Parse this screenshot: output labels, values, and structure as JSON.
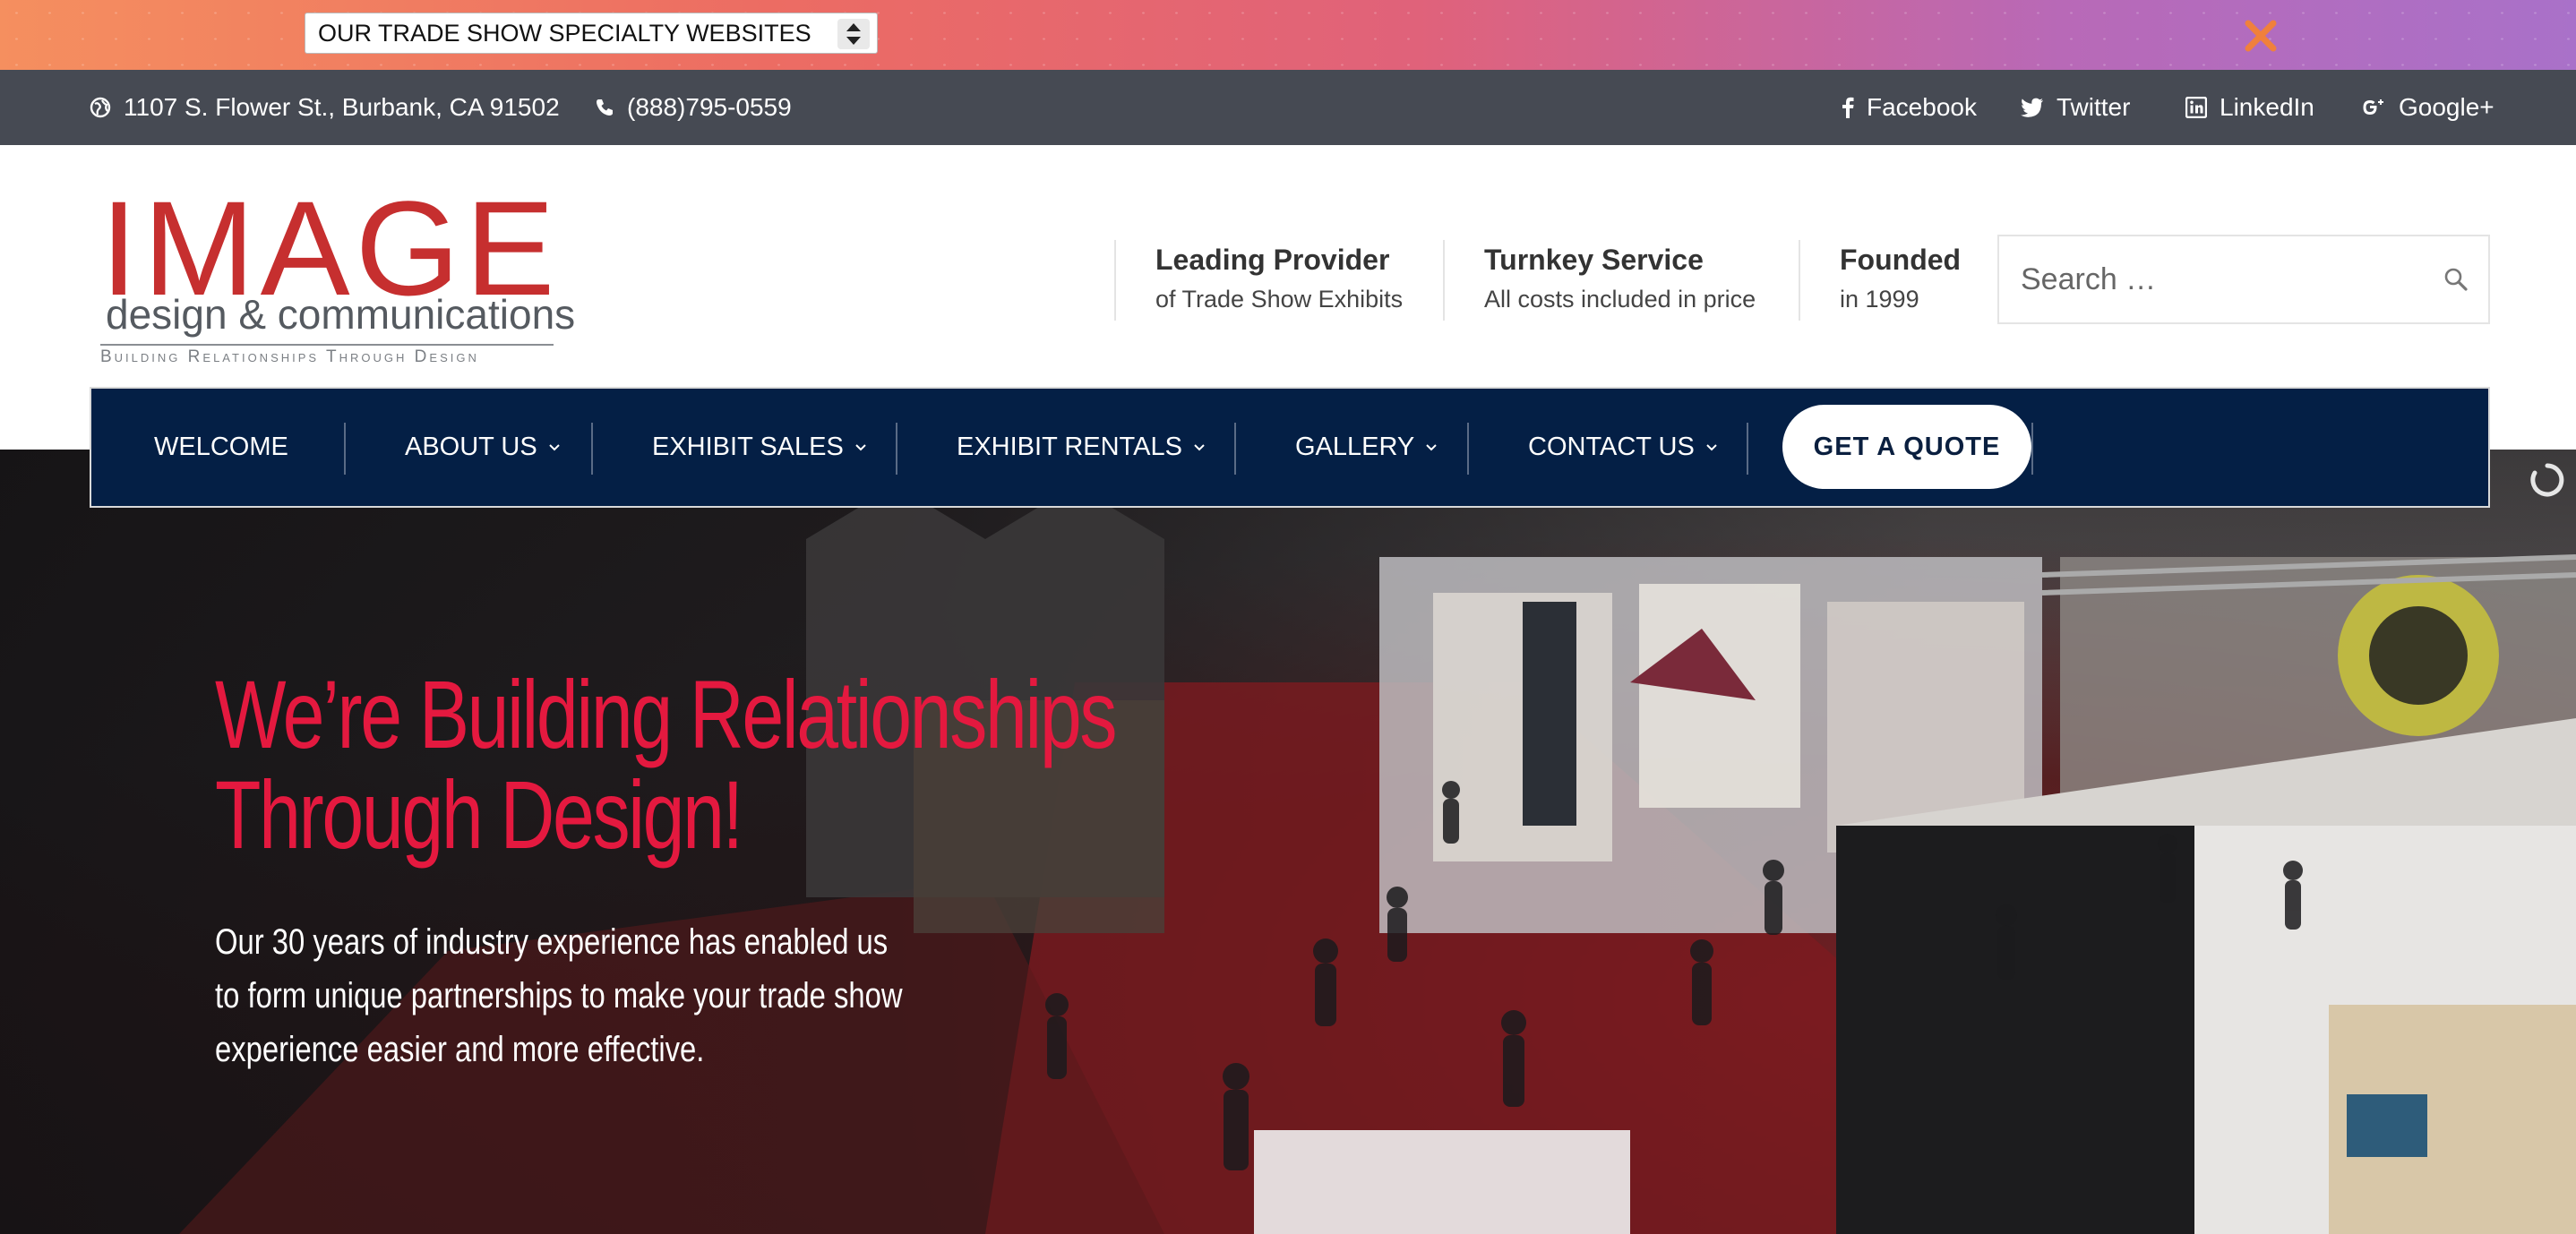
{
  "promo": {
    "select_value": "OUR TRADE SHOW SPECIALTY WEBSITES"
  },
  "contact": {
    "address": "1107 S. Flower St., Burbank, CA 91502",
    "phone": "(888)795-0559",
    "social": [
      {
        "label": "Facebook"
      },
      {
        "label": "Twitter"
      },
      {
        "label": "LinkedIn"
      },
      {
        "label": "Google+"
      }
    ]
  },
  "logo": {
    "main": "IMAGE",
    "sub": "design & communications",
    "tagline": "Building Relationships Through Design"
  },
  "features": [
    {
      "title": "Leading Provider",
      "subtitle": "of Trade Show Exhibits"
    },
    {
      "title": "Turnkey Service",
      "subtitle": "All costs included in price"
    },
    {
      "title": "Founded",
      "subtitle": "in 1999"
    }
  ],
  "search": {
    "placeholder": "Search …"
  },
  "nav": {
    "items": [
      {
        "label": "WELCOME"
      },
      {
        "label": "ABOUT US"
      },
      {
        "label": "EXHIBIT SALES"
      },
      {
        "label": "EXHIBIT RENTALS"
      },
      {
        "label": "GALLERY"
      },
      {
        "label": "CONTACT US"
      }
    ],
    "cta": "GET A QUOTE"
  },
  "hero": {
    "title_line1": "We’re Building Relationships",
    "title_line2": "Through Design!",
    "text_line1": "Our 30 years of industry experience has enabled us",
    "text_line2": "to form unique partnerships to make your trade show",
    "text_line3": "experience easier and more effective."
  },
  "colors": {
    "accent": "#e4193f",
    "nav_bg": "#041f45",
    "contact_bar": "#464a53",
    "logo_red": "#c62f2f"
  }
}
